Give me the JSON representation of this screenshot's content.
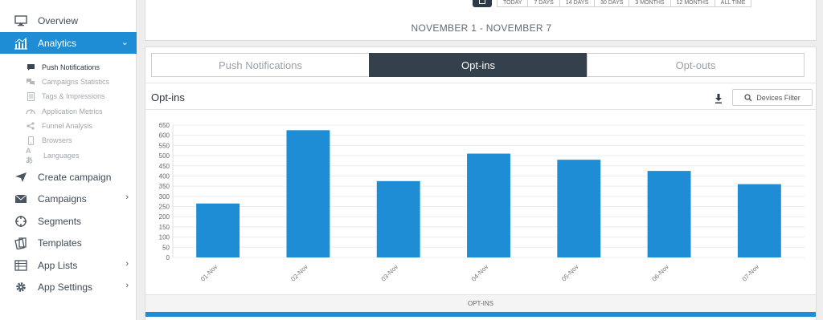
{
  "sidebar": {
    "items": [
      {
        "label": "Overview",
        "icon": "monitor-icon"
      },
      {
        "label": "Analytics",
        "icon": "analytics-chart-icon",
        "active": true
      },
      {
        "label": "Create campaign",
        "icon": "paper-plane-icon"
      },
      {
        "label": "Campaigns",
        "icon": "envelope-icon"
      },
      {
        "label": "Segments",
        "icon": "crosshair-icon"
      },
      {
        "label": "Templates",
        "icon": "cards-icon"
      },
      {
        "label": "App Lists",
        "icon": "list-icon"
      },
      {
        "label": "App Settings",
        "icon": "gear-icon"
      }
    ],
    "sub_items": [
      {
        "label": "Push Notifications",
        "icon": "chat-bubble-icon"
      },
      {
        "label": "Campaigns Statistics",
        "icon": "chat-bubbles-icon"
      },
      {
        "label": "Tags & Impressions",
        "icon": "document-icon"
      },
      {
        "label": "Application Metrics",
        "icon": "gauge-icon"
      },
      {
        "label": "Funnel Analysis",
        "icon": "share-icon"
      },
      {
        "label": "Browsers",
        "icon": "phone-icon"
      },
      {
        "label": "Languages",
        "icon": "translate-icon"
      }
    ]
  },
  "range_buttons": [
    "TODAY",
    "7 DAYS",
    "14 DAYS",
    "30 DAYS",
    "3 MONTHS",
    "12 MONTHS",
    "ALL TIME"
  ],
  "date_range": "NOVEMBER 1 - NOVEMBER 7",
  "tabs": [
    "Push Notifications",
    "Opt-ins",
    "Opt-outs"
  ],
  "section": {
    "title": "Opt-ins",
    "filter_label": "Devices Filter"
  },
  "footer_label": "OPT-INS",
  "colors": {
    "accent": "#1f8dd6",
    "dark_tab": "#34404c"
  },
  "chart_data": {
    "type": "bar",
    "categories": [
      "01-Nov",
      "02-Nov",
      "03-Nov",
      "04-Nov",
      "05-Nov",
      "06-Nov",
      "07-Nov"
    ],
    "values": [
      265,
      625,
      375,
      510,
      480,
      425,
      360
    ],
    "ylim": [
      0,
      650
    ],
    "yticks": [
      0,
      50,
      100,
      150,
      200,
      250,
      300,
      350,
      400,
      450,
      500,
      550,
      600,
      650
    ],
    "grid": true,
    "bar_color": "#1f8dd6"
  }
}
